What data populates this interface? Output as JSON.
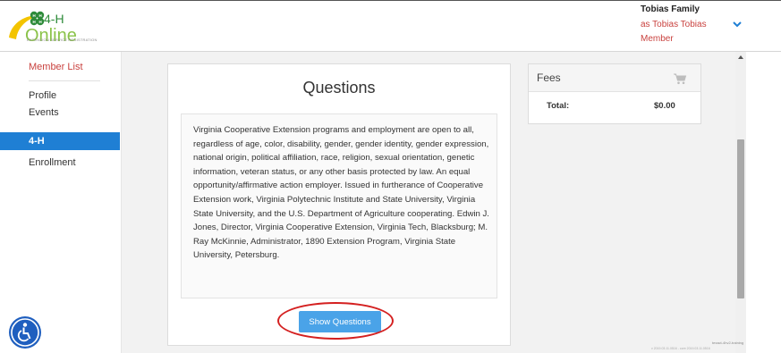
{
  "header": {
    "logo_text": "4-H Online",
    "logo_subtext": "EXTENSION SERVICE REGISTRATION",
    "user": {
      "family": "Tobias Family",
      "as_line": "as Tobias Tobias",
      "role": "Member"
    }
  },
  "sidebar": {
    "member_list": "Member List",
    "profile": "Profile",
    "events": "Events",
    "active_section": "4-H",
    "enrollment": "Enrollment"
  },
  "questions": {
    "title": "Questions",
    "statement": "Virginia Cooperative Extension programs and employment are open to all, regardless of age, color, disability, gender, gender identity, gender expression, national origin, political affiliation, race, religion, sexual orientation, genetic information, veteran status, or any other basis protected by law. An equal opportunity/affirmative action employer. Issued in furtherance of Cooperative Extension work, Virginia Polytechnic Institute and State University, Virginia State University, and the U.S. Department of Agriculture cooperating. Edwin J. Jones, Director, Virginia Cooperative Extension, Virginia Tech, Blacksburg; M. Ray McKinnie, Administrator, 1890 Extension Program, Virginia State University, Petersburg.",
    "show_button": "Show Questions"
  },
  "fees": {
    "title": "Fees",
    "total_label": "Total:",
    "total_value": "$0.00"
  },
  "footer": {
    "env": "texact-4hv2-training",
    "build": "v 2019.03.11.0516 - core 2019.03.11.0516"
  },
  "colors": {
    "accent": "#1f7fd4",
    "button": "#4aa3e8",
    "link_red": "#c9423f",
    "logo_green": "#8bc34a",
    "annotation": "#d42020"
  },
  "icons": {
    "cart": "cart-icon",
    "chevron": "chevron-down-icon",
    "accessibility": "accessibility-icon"
  }
}
